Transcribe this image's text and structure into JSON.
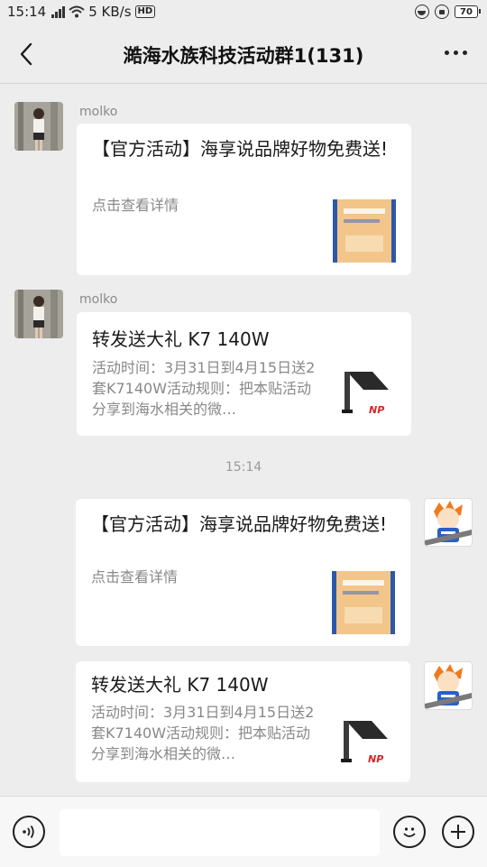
{
  "status_bar": {
    "time": "15:14",
    "network_speed": "5 KB/s",
    "hd_label": "HD",
    "battery_level": "70"
  },
  "header": {
    "title": "澔海水族科技活动群1(131)"
  },
  "messages": [
    {
      "sender": "molko",
      "title": "【官方活动】海享说品牌好物免费送!",
      "desc": "点击查看详情"
    },
    {
      "sender": "molko",
      "title": "转发送大礼 K7 140W",
      "desc": "活动时间：3月31日到4月15日送2套K7140W活动规则：把本贴活动分享到海水相关的微…"
    },
    {
      "title": "【官方活动】海享说品牌好物免费送!",
      "desc": "点击查看详情"
    },
    {
      "title": "转发送大礼 K7 140W",
      "desc": "活动时间：3月31日到4月15日送2套K7140W活动规则：把本贴活动分享到海水相关的微…"
    }
  ],
  "timestamp": "15:14",
  "thumb_brand": "NP",
  "colors": {
    "background": "#ededed",
    "card": "#ffffff"
  }
}
